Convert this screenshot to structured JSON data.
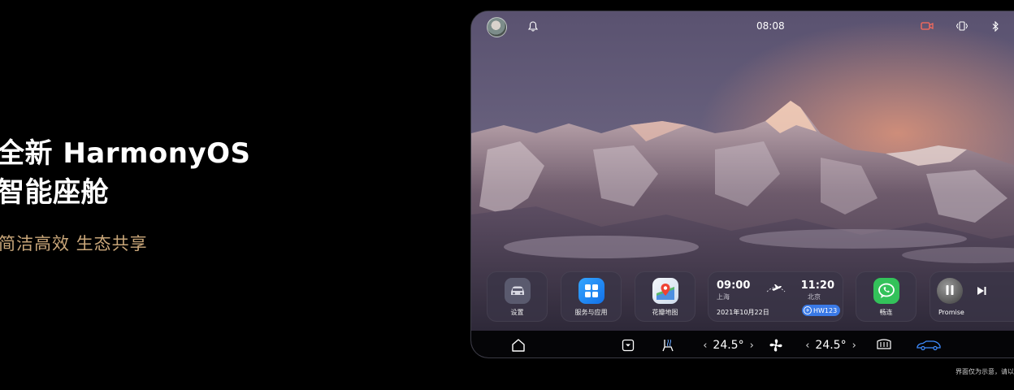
{
  "promo": {
    "title_line1": "全新 HarmonyOS",
    "title_line2": "智能座舱",
    "tagline": "简洁高效 生态共享"
  },
  "disclaimer": "界面仅为示意，请以",
  "status_bar": {
    "time": "08:08",
    "icons": [
      "avatar",
      "bell-icon",
      "camera-record-icon",
      "vibrate-icon",
      "bluetooth-icon"
    ]
  },
  "dock": {
    "apps": [
      {
        "label": "设置",
        "icon": "car-settings-icon",
        "color": "#5a5a6e"
      },
      {
        "label": "服务与应用",
        "icon": "app-grid-icon",
        "color": "#1e8cf5"
      },
      {
        "label": "花瓣地图",
        "icon": "map-pin-icon",
        "color": "#e8eef6"
      }
    ],
    "flight_card": {
      "depart_time": "09:00",
      "depart_city": "上海",
      "arrive_time": "11:20",
      "arrive_city": "北京",
      "date": "2021年10月22日",
      "flight_no": "HW123"
    },
    "messaging_app": {
      "label": "畅连",
      "icon": "chat-bubble-icon",
      "color": "#33c25a"
    },
    "music": {
      "label": "Promise",
      "state": "playing"
    }
  },
  "bottom_bar": {
    "driver_temp": "24.5°",
    "passenger_temp": "24.5°",
    "icons": [
      "home-icon",
      "drawer-icon",
      "seat-heat-icon",
      "fan-icon",
      "rear-defrost-icon",
      "car-status-icon"
    ]
  },
  "colors": {
    "tagline": "#c9a679",
    "accent_blue": "#3a79e6",
    "dock_tile": "#3a3446"
  }
}
